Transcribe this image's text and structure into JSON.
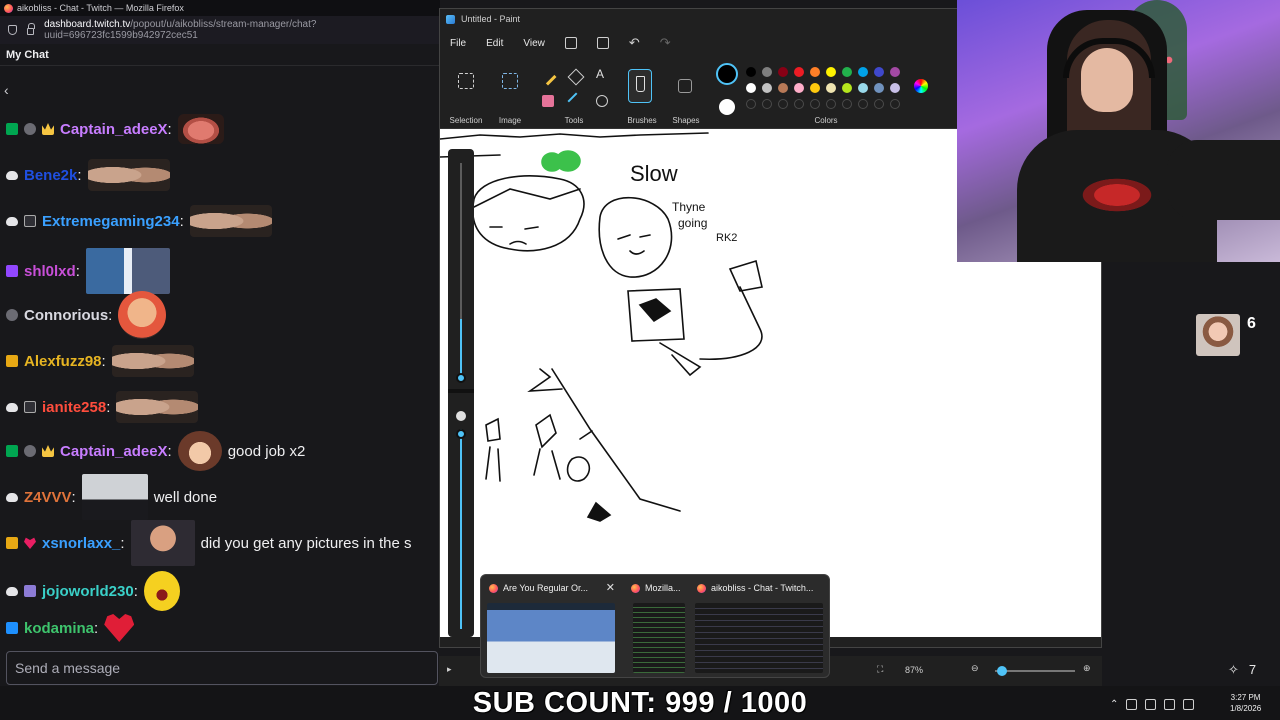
{
  "browser": {
    "window_title": "aikobliss - Chat - Twitch — Mozilla Firefox",
    "url_host": "dashboard.twitch.tv",
    "url_path": "/popout/u/aikobliss/stream-manager/chat?uuid=696723fc1599b942972cec51"
  },
  "chat": {
    "header": "My Chat",
    "back_icon": "chevron-left-icon",
    "messages": [
      {
        "user": "Captain_adeeX",
        "color": "#c77dff",
        "text": ""
      },
      {
        "user": "Bene2k",
        "color": "#1f4fe0",
        "text": ""
      },
      {
        "user": "Extremegaming234",
        "color": "#3aa0ff",
        "text": ""
      },
      {
        "user": "shl0lxd",
        "color": "#c84fd8",
        "text": ""
      },
      {
        "user": "Connorious",
        "color": "#d8d8e0",
        "text": ""
      },
      {
        "user": "Alexfuzz98",
        "color": "#e6b422",
        "text": ""
      },
      {
        "user": "ianite258",
        "color": "#ff4d3d",
        "text": ""
      },
      {
        "user": "Captain_adeeX",
        "color": "#c77dff",
        "text": "good job x2"
      },
      {
        "user": "Z4VVV",
        "color": "#e0733a",
        "text": "well done"
      },
      {
        "user": "xsnorlaxx_",
        "color": "#3aa0ff",
        "text": "did you get any pictures in the s"
      },
      {
        "user": "jojoworld230",
        "color": "#3ad0c8",
        "text": ""
      },
      {
        "user": "kodamina",
        "color": "#3ec46d",
        "text": ""
      }
    ],
    "input_placeholder": "Send a message"
  },
  "paint": {
    "title": "Untitled - Paint",
    "menu": [
      "File",
      "Edit",
      "View"
    ],
    "groups": {
      "selection": "Selection",
      "image": "Image",
      "tools": "Tools",
      "brushes": "Brushes",
      "shapes": "Shapes",
      "colors": "Colors"
    },
    "zoom": "87%",
    "drawing_text": [
      "Slow",
      "Thyne",
      "going",
      "RK2"
    ],
    "palette_row1": [
      "#000000",
      "#7f7f7f",
      "#880015",
      "#ed1c24",
      "#ff7f27",
      "#fff200",
      "#22b14c",
      "#00a2e8",
      "#3f48cc",
      "#a349a4"
    ],
    "palette_row2": [
      "#ffffff",
      "#c3c3c3",
      "#b97a57",
      "#ffaec9",
      "#ffc90e",
      "#efe4b0",
      "#b5e61d",
      "#99d9ea",
      "#7092be",
      "#c8bfe7"
    ]
  },
  "taskbar_preview": {
    "windows": [
      {
        "title": "Are You Regular Or..."
      },
      {
        "title": "Mozilla..."
      },
      {
        "title": "aikobliss - Chat - Twitch..."
      }
    ]
  },
  "stream": {
    "viewer_count": "6",
    "sub_goal": "SUB COUNT: 999 / 1000"
  },
  "system": {
    "time": "3:27 PM",
    "date": "1/8/2026"
  }
}
